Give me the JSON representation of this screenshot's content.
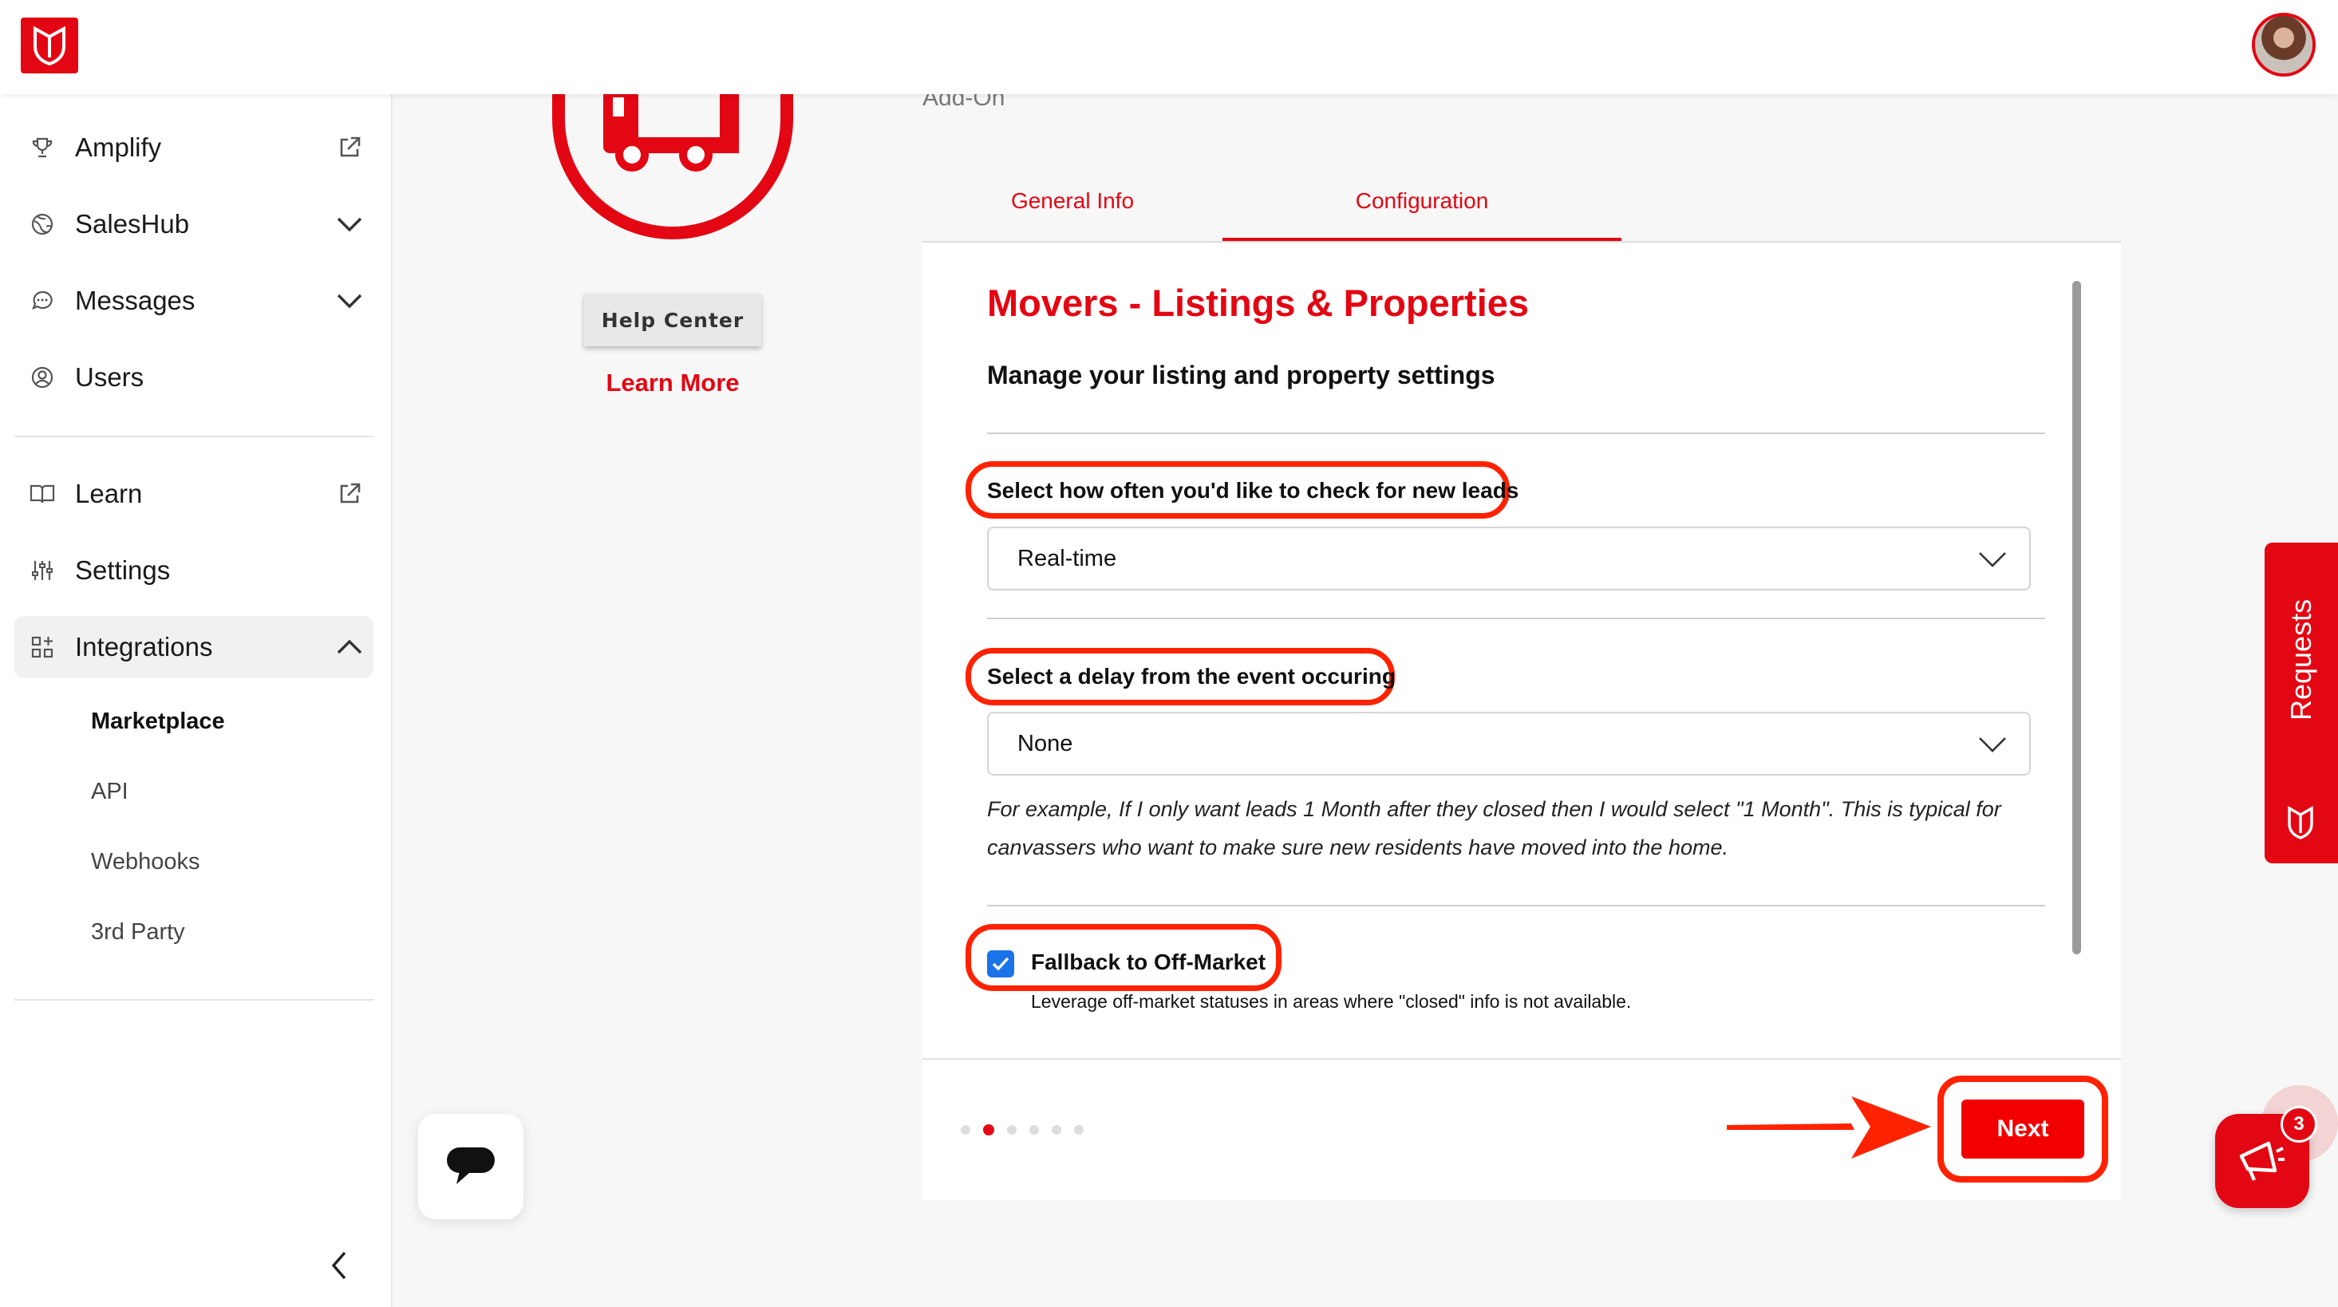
{
  "header": {
    "logo_alt": "brand-logo",
    "avatar": "user-avatar"
  },
  "sidebar": {
    "items": [
      {
        "label": "Amplify",
        "icon": "trophy-icon",
        "trailing": "external-link-icon"
      },
      {
        "label": "SalesHub",
        "icon": "globe-icon",
        "trailing": "chevron-down-icon"
      },
      {
        "label": "Messages",
        "icon": "chat-bubble-icon",
        "trailing": "chevron-down-icon"
      },
      {
        "label": "Users",
        "icon": "user-circle-icon",
        "trailing": ""
      },
      {
        "label": "Learn",
        "icon": "book-icon",
        "trailing": "external-link-icon"
      },
      {
        "label": "Settings",
        "icon": "sliders-icon",
        "trailing": ""
      },
      {
        "label": "Integrations",
        "icon": "grid-plus-icon",
        "trailing": "chevron-up-icon"
      }
    ],
    "subitems": [
      {
        "label": "Marketplace",
        "active": true
      },
      {
        "label": "API",
        "active": false
      },
      {
        "label": "Webhooks",
        "active": false
      },
      {
        "label": "3rd Party",
        "active": false
      }
    ]
  },
  "left_column": {
    "help_center_label": "Help Center",
    "learn_more_label": "Learn More"
  },
  "main": {
    "addon_label": "Add-On",
    "tabs": [
      {
        "label": "General Info",
        "active": false
      },
      {
        "label": "Configuration",
        "active": true
      }
    ],
    "title": "Movers - Listings & Properties",
    "subtitle": "Manage your listing and property settings",
    "field1": {
      "label": "Select how often you'd like to check for new leads",
      "value": "Real-time"
    },
    "field2": {
      "label": "Select a delay from the event occuring",
      "value": "None"
    },
    "helptext": "For example, If I only want leads 1 Month after they closed then I would select \"1 Month\". This is typical for canvassers who want to make sure new residents have moved into the home.",
    "checkbox": {
      "label": "Fallback to Off-Market",
      "checked": true,
      "description": "Leverage off-market statuses in areas where \"closed\" info is not available."
    },
    "pager": {
      "total": 6,
      "active_index": 1
    },
    "next_label": "Next"
  },
  "floating": {
    "requests_label": "Requests",
    "notification_count": "3"
  },
  "colors": {
    "brand_red": "#e30613",
    "highlight": "#ff2200",
    "checkbox_blue": "#1a73e8"
  }
}
